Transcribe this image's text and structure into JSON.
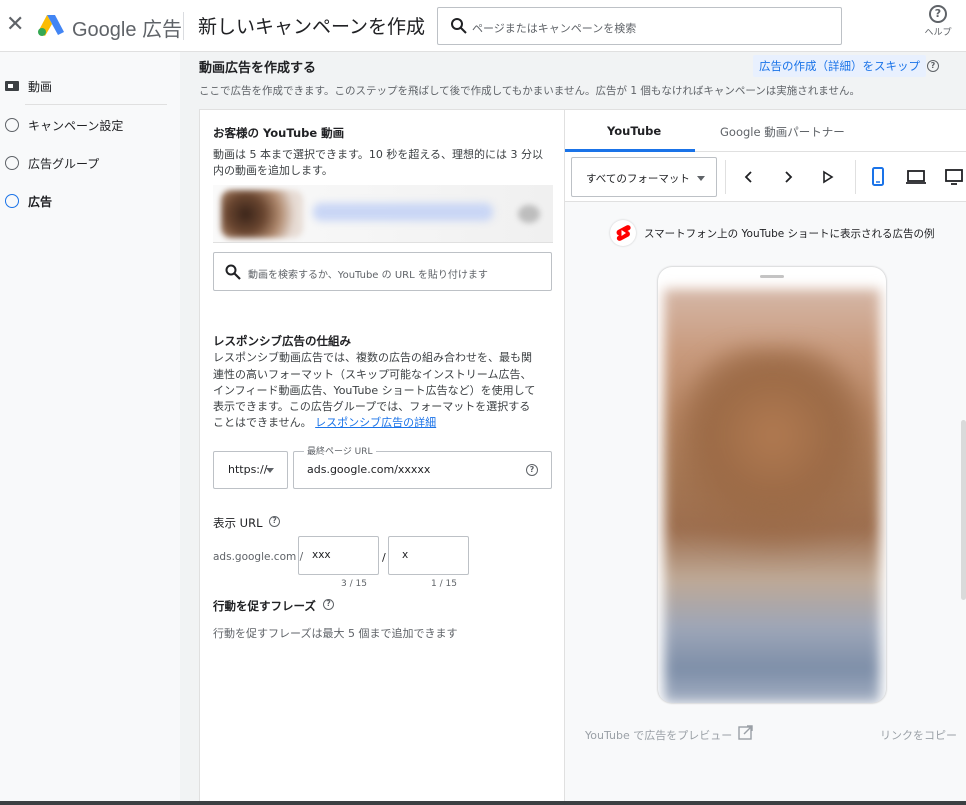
{
  "topbar": {
    "brand_text": "Google 広告",
    "title": "新しいキャンペーンを作成",
    "search_placeholder": "ページまたはキャンペーンを検索",
    "help_label": "ヘルプ"
  },
  "sidebar": {
    "items": [
      {
        "label": "動画"
      },
      {
        "label": "キャンペーン設定"
      },
      {
        "label": "広告グループ"
      },
      {
        "label": "広告"
      }
    ]
  },
  "main": {
    "header_title": "動画広告を作成する",
    "skip_label": "広告の作成（詳細）をスキップ",
    "header_desc": "ここで広告を作成できます。このステップを飛ばして後で作成してもかまいません。広告が 1 個もなければキャンペーンは実施されません。"
  },
  "video_section": {
    "title": "お客様の YouTube 動画",
    "desc_line1": "動画は 5 本まで選択できます。10 秒を超える、理想的には 3 分以",
    "desc_line2": "内の動画を追加します。",
    "search_placeholder": "動画を検索するか、YouTube の URL を貼り付けます"
  },
  "responsive": {
    "title": "レスポンシブ広告の仕組み",
    "lines": [
      "レスポンシブ動画広告では、複数の広告の組み合わせを、最も関",
      "連性の高いフォーマット（スキップ可能なインストリーム広告、",
      "インフィード動画広告、YouTube ショート広告など）を使用して",
      "表示できます。この広告グループでは、フォーマットを選択する",
      "ことはできません。"
    ],
    "link": "レスポンシブ広告の詳細"
  },
  "url_fields": {
    "protocol": "https://",
    "final_url_label": "最終ページ URL",
    "final_url_value": "ads.google.com/xxxxx"
  },
  "display_url": {
    "title": "表示 URL",
    "base": "ads.google.com /",
    "path1": "xxx",
    "path2": "x",
    "path1_counter": "3 / 15",
    "path2_counter": "1 / 15"
  },
  "cta": {
    "title": "行動を促すフレーズ",
    "text": "行動を促すフレーズは最大 5 個まで追加できます"
  },
  "preview": {
    "tabs": [
      "YouTube",
      "Google 動画パートナー"
    ],
    "format_select": "すべてのフォーマット",
    "caption": "スマートフォン上の YouTube ショートに表示される広告の例",
    "preview_link": "YouTube で広告をプレビュー",
    "copy_link": "リンクをコピー"
  },
  "colors": {
    "accent": "#1a73e8",
    "skip_bg": "#e8f0fe",
    "shorts_red": "#ff0000"
  }
}
